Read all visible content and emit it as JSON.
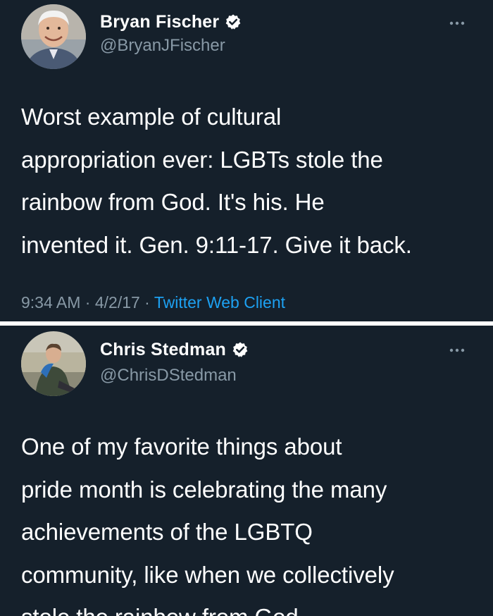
{
  "tweets": [
    {
      "name": "Bryan Fischer",
      "handle": "@BryanJFischer",
      "text": "Worst example of cultural\nappropriation ever: LGBTs stole the\nrainbow from God. It's his. He\ninvented it. Gen. 9:11-17. Give it back.",
      "time": "9:34 AM",
      "date": "4/2/17",
      "source": "Twitter Web Client"
    },
    {
      "name": "Chris Stedman",
      "handle": "@ChrisDStedman",
      "text": "One of my favorite things about\npride month is celebrating the many\nachievements of the LGBTQ\ncommunity, like when we collectively\nstole the rainbow from God"
    }
  ],
  "meta_separator": " · ",
  "icons": {
    "verified": "verified-badge-icon",
    "more": "more-options-icon"
  },
  "colors": {
    "background": "#15202b",
    "text": "#ffffff",
    "secondary_text": "#8899a6",
    "link": "#1da1f2",
    "divider": "#ffffff"
  }
}
